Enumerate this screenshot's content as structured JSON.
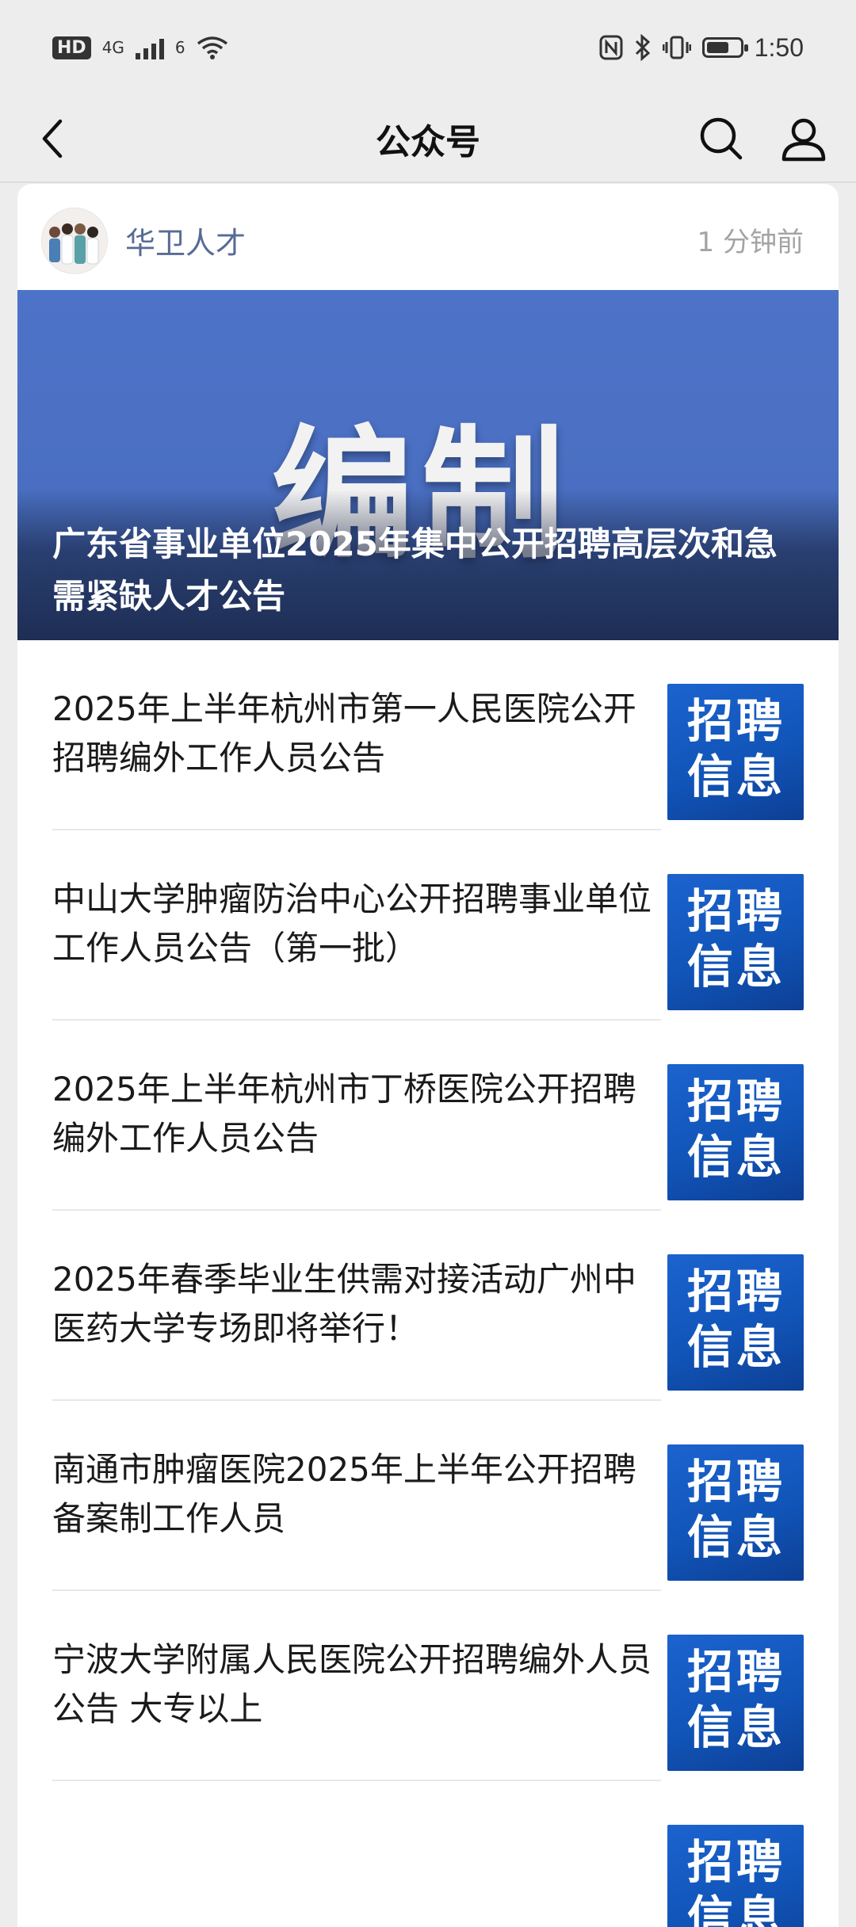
{
  "status_bar": {
    "hd": "HD",
    "network": "4G",
    "wifi_badge": "6",
    "time": "1:50"
  },
  "nav": {
    "title": "公众号"
  },
  "card": {
    "account_name": "华卫人才",
    "post_time": "1 分钟前",
    "hero": {
      "image_text": "编制",
      "title": "广东省事业单位2025年集中公开招聘高层次和急需紧缺人才公告"
    },
    "thumbnail_text": "招聘信息",
    "articles": [
      {
        "title": "2025年上半年杭州市第一人民医院公开招聘编外工作人员公告",
        "thumb": "招聘信息"
      },
      {
        "title": "中山大学肿瘤防治中心公开招聘事业单位工作人员公告（第一批）",
        "thumb": "招聘信息"
      },
      {
        "title": "2025年上半年杭州市丁桥医院公开招聘编外工作人员公告",
        "thumb": "招聘信息"
      },
      {
        "title": "2025年春季毕业生供需对接活动广州中医药大学专场即将举行！",
        "thumb": "招聘信息"
      },
      {
        "title": "南通市肿瘤医院2025年上半年公开招聘备案制工作人员",
        "thumb": "招聘信息"
      },
      {
        "title": "宁波大学附属人民医院公开招聘编外人员公告 大专以上",
        "thumb": "招聘信息"
      },
      {
        "title": "",
        "thumb": "招聘信息"
      }
    ]
  },
  "colors": {
    "background": "#ededed",
    "link": "#576b95",
    "hero": "#4d73c9",
    "thumb": "#1155b9"
  }
}
